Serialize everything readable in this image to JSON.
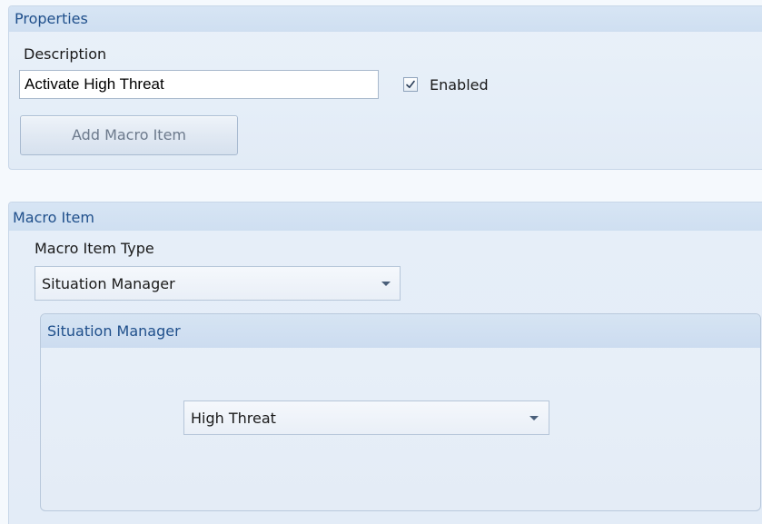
{
  "properties": {
    "title": "Properties",
    "description_label": "Description",
    "description_value": "Activate High Threat",
    "enabled_label": "Enabled",
    "enabled_checked": true,
    "add_button_label": "Add Macro Item"
  },
  "macro_item": {
    "title": "Macro Item",
    "type_label": "Macro Item Type",
    "type_selected": "Situation Manager",
    "situation_manager": {
      "title": "Situation Manager",
      "selected": "High Threat"
    }
  },
  "icons": {
    "checkmark": "check-icon",
    "dropdown": "chevron-down-icon"
  },
  "colors": {
    "panel_title": "#1f4f8b",
    "panel_bg": "#e5eef8",
    "header_bg": "#d3e2f3",
    "border": "#c7d6e8"
  }
}
